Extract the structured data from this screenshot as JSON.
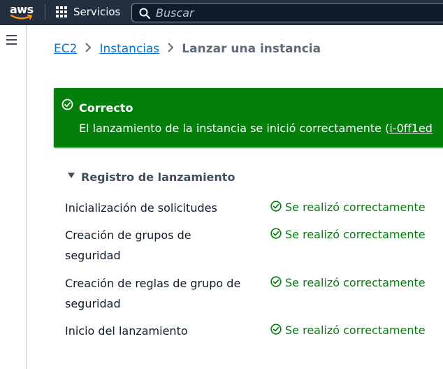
{
  "topbar": {
    "logo_text": "aws",
    "services_label": "Servicios",
    "search_placeholder": "Buscar"
  },
  "breadcrumb": {
    "items": [
      "EC2",
      "Instancias"
    ],
    "current": "Lanzar una instancia"
  },
  "flash": {
    "title": "Correcto",
    "message": "El lanzamiento de la instancia se inició correctamente (",
    "instance_link": "i-0ff1ed"
  },
  "launch_log": {
    "title": "Registro de lanzamiento",
    "steps": [
      {
        "label": "Inicialización de solicitudes",
        "status": "Se realizó correctamente"
      },
      {
        "label": "Creación de grupos de seguridad",
        "status": "Se realizó correctamente"
      },
      {
        "label": "Creación de reglas de grupo de seguridad",
        "status": "Se realizó correctamente"
      },
      {
        "label": "Inicio del lanzamiento",
        "status": "Se realizó correctamente"
      }
    ]
  },
  "colors": {
    "topbar_bg": "#232f3e",
    "link": "#0972d3",
    "success_bg": "#037f0c",
    "success_text": "#037f0c"
  },
  "icons": [
    "aws-logo",
    "grid-icon",
    "search-icon",
    "hamburger-icon",
    "chevron-right-icon",
    "check-circle-icon",
    "caret-down-icon"
  ]
}
